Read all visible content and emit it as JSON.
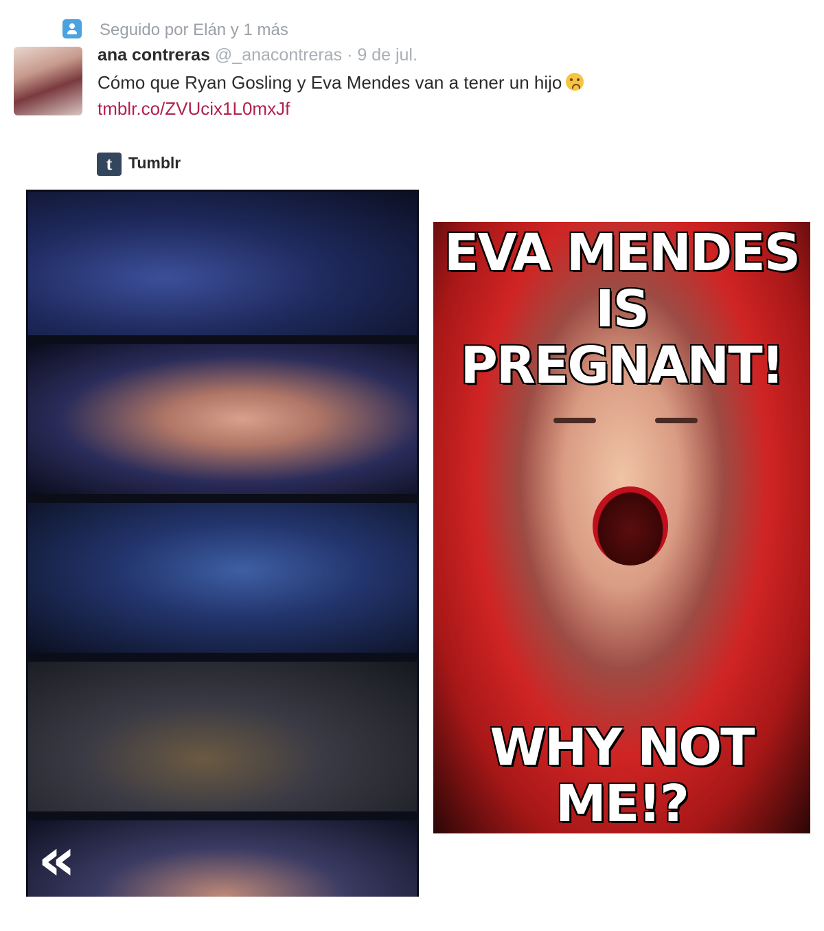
{
  "context": {
    "text": "Seguido por Elán y 1 más",
    "icon": "follow-person-icon"
  },
  "tweet": {
    "name": "ana contreras",
    "handle": "@_anacontreras",
    "separator": "·",
    "date": "9 de jul.",
    "text": "Cómo que Ryan Gosling y Eva Mendes van a tener un hijo",
    "emoji": "worried-face-emoji",
    "link": "tmblr.co/ZVUcix1L0mxJf"
  },
  "card": {
    "source_logo": "t",
    "source_label": "Tumblr"
  },
  "comic": {
    "nav_arrow": "«"
  },
  "meme": {
    "top_text": "EVA MENDES IS PREGNANT!",
    "bottom_text": "WHY NOT ME!?"
  },
  "colors": {
    "link": "#b1224d",
    "muted": "#a9afb5",
    "tumblr": "#34465d",
    "context_icon": "#4aa3df"
  }
}
